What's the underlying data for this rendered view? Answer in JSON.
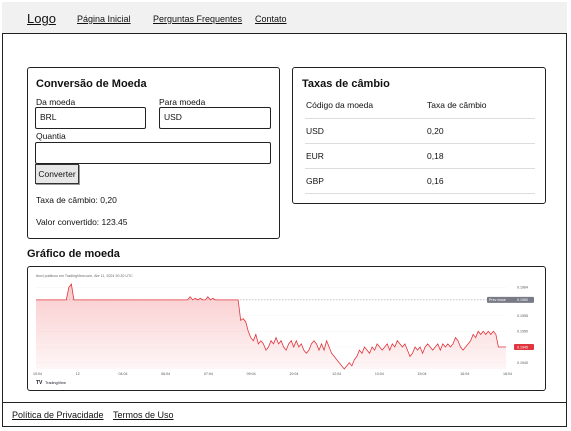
{
  "header": {
    "logo": "Logo",
    "nav": [
      "Página Inicial",
      "Perguntas Frequentes",
      "Contato"
    ]
  },
  "converter": {
    "title": "Conversão de Moeda",
    "from_label": "Da moeda",
    "from_value": "BRL",
    "to_label": "Para moeda",
    "to_value": "USD",
    "amount_label": "Quantia",
    "amount_value": "",
    "convert_button": "Converter",
    "rate_text": "Taxa de câmbio: 0,20",
    "converted_text": "Valor convertido: 123.45"
  },
  "rates": {
    "title": "Taxas de câmbio",
    "columns": [
      "Código da moeda",
      "Taxa de câmbio"
    ],
    "rows": [
      [
        "USD",
        "0,20"
      ],
      [
        "EUR",
        "0,18"
      ],
      [
        "GBP",
        "0,16"
      ]
    ]
  },
  "chart_section": {
    "title": "Gráfico de moeda",
    "caption": "Ibovl publicou em TradingView.com, Abr 11, 2024 20:20 UTC",
    "brand": "TradingView",
    "prev_close_label": "Prev close",
    "prev_close_value": "0.1960",
    "current_value": "0.1945",
    "accent_line": "#e0353d",
    "accent_fill": "#f9c4c6"
  },
  "chart_data": {
    "type": "area",
    "x_ticks": [
      "19:04",
      "12",
      "04:04",
      "06:04",
      "07:04",
      "09:04",
      "10:04",
      "12:04",
      "13:04",
      "15:04",
      "16:04",
      "18:04"
    ],
    "y_ticks": [
      0.1964,
      0.196,
      0.1955,
      0.195,
      0.1945,
      0.194
    ],
    "ylim": [
      0.1938,
      0.1966
    ],
    "values": [
      0.196,
      0.196,
      0.196,
      0.196,
      0.196,
      0.196,
      0.196,
      0.196,
      0.196,
      0.196,
      0.196,
      0.196,
      0.196,
      0.1964,
      0.1965,
      0.196,
      0.196,
      0.196,
      0.196,
      0.196,
      0.196,
      0.196,
      0.196,
      0.196,
      0.196,
      0.196,
      0.196,
      0.196,
      0.196,
      0.196,
      0.196,
      0.196,
      0.196,
      0.196,
      0.196,
      0.196,
      0.196,
      0.196,
      0.196,
      0.196,
      0.196,
      0.196,
      0.196,
      0.196,
      0.196,
      0.196,
      0.196,
      0.196,
      0.196,
      0.196,
      0.196,
      0.196,
      0.196,
      0.196,
      0.196,
      0.196,
      0.196,
      0.196,
      0.196,
      0.196,
      0.196,
      0.1961,
      0.196,
      0.19605,
      0.196,
      0.19605,
      0.196,
      0.196,
      0.1961,
      0.196,
      0.19605,
      0.196,
      0.196,
      0.196,
      0.196,
      0.196,
      0.196,
      0.196,
      0.196,
      0.196,
      0.196,
      0.19535,
      0.1954,
      0.1953,
      0.195,
      0.1948,
      0.1947,
      0.1949,
      0.1946,
      0.1947,
      0.1946,
      0.1944,
      0.1945,
      0.1947,
      0.1946,
      0.1948,
      0.1946,
      0.1947,
      0.1945,
      0.1944,
      0.1946,
      0.1947,
      0.1945,
      0.1947,
      0.1945,
      0.1946,
      0.1944,
      0.1943,
      0.1944,
      0.1946,
      0.1947,
      0.1946,
      0.1944,
      0.1946,
      0.1944,
      0.1947,
      0.1945,
      0.1943,
      0.1942,
      0.1941,
      0.194,
      0.1939,
      0.1938,
      0.1939,
      0.194,
      0.1939,
      0.1941,
      0.1942,
      0.1944,
      0.1943,
      0.1945,
      0.1944,
      0.1943,
      0.1945,
      0.1944,
      0.1946,
      0.1945,
      0.1944,
      0.1945,
      0.1946,
      0.1944,
      0.1946,
      0.1945,
      0.1947,
      0.1946,
      0.1945,
      0.1946,
      0.1944,
      0.1942,
      0.1943,
      0.1945,
      0.1944,
      0.1945,
      0.1943,
      0.1945,
      0.1946,
      0.1945,
      0.1944,
      0.1945,
      0.1946,
      0.1944,
      0.1946,
      0.1945,
      0.1946,
      0.1945,
      0.1946,
      0.1948,
      0.1947,
      0.1945,
      0.1944,
      0.1945,
      0.1946,
      0.1947,
      0.1949,
      0.1948,
      0.195,
      0.1949,
      0.195,
      0.1949,
      0.195,
      0.1949,
      0.195,
      0.1949,
      0.1945,
      0.1945,
      0.1945,
      0.1945
    ]
  },
  "footer": {
    "links": [
      "Política de Privacidade",
      "Termos de Uso"
    ]
  }
}
